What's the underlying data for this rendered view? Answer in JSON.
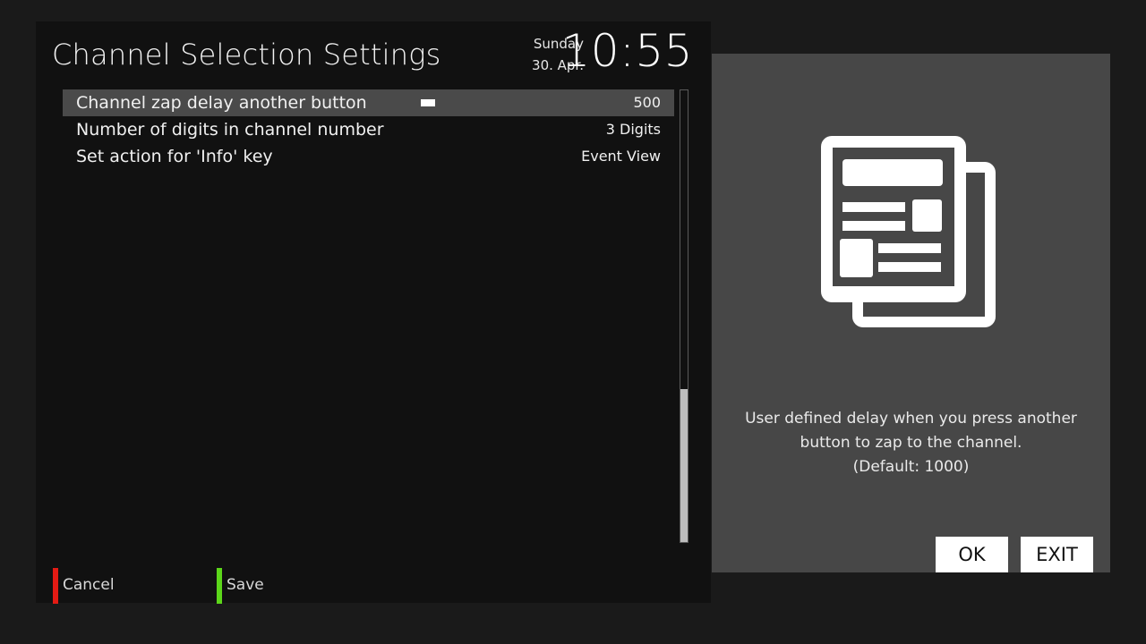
{
  "header": {
    "title": "Channel Selection Settings",
    "day": "Sunday",
    "date": "30. Apr.",
    "time": "10:55"
  },
  "settings": [
    {
      "label": "Channel zap delay another button",
      "value": "500",
      "selected": true,
      "has_slider": true
    },
    {
      "label": "Number of digits in channel number",
      "value": "3 Digits",
      "selected": false
    },
    {
      "label": "Set action for 'Info' key",
      "value": "Event View",
      "selected": false
    }
  ],
  "color_keys": {
    "red": {
      "label": "Cancel",
      "color": "#e31b14"
    },
    "green": {
      "label": "Save",
      "color": "#5cd61a"
    }
  },
  "help": {
    "line1": "User defined delay when you press another",
    "line2": "button to zap to the channel.",
    "line3": "(Default: 1000)",
    "icon": "news-document-icon"
  },
  "buttons": {
    "ok_label": "OK",
    "exit_label": "EXIT"
  },
  "colors": {
    "background": "#1a1a1a",
    "panel": "#111111",
    "side_panel": "#474747",
    "selection": "#4a4a4a"
  }
}
